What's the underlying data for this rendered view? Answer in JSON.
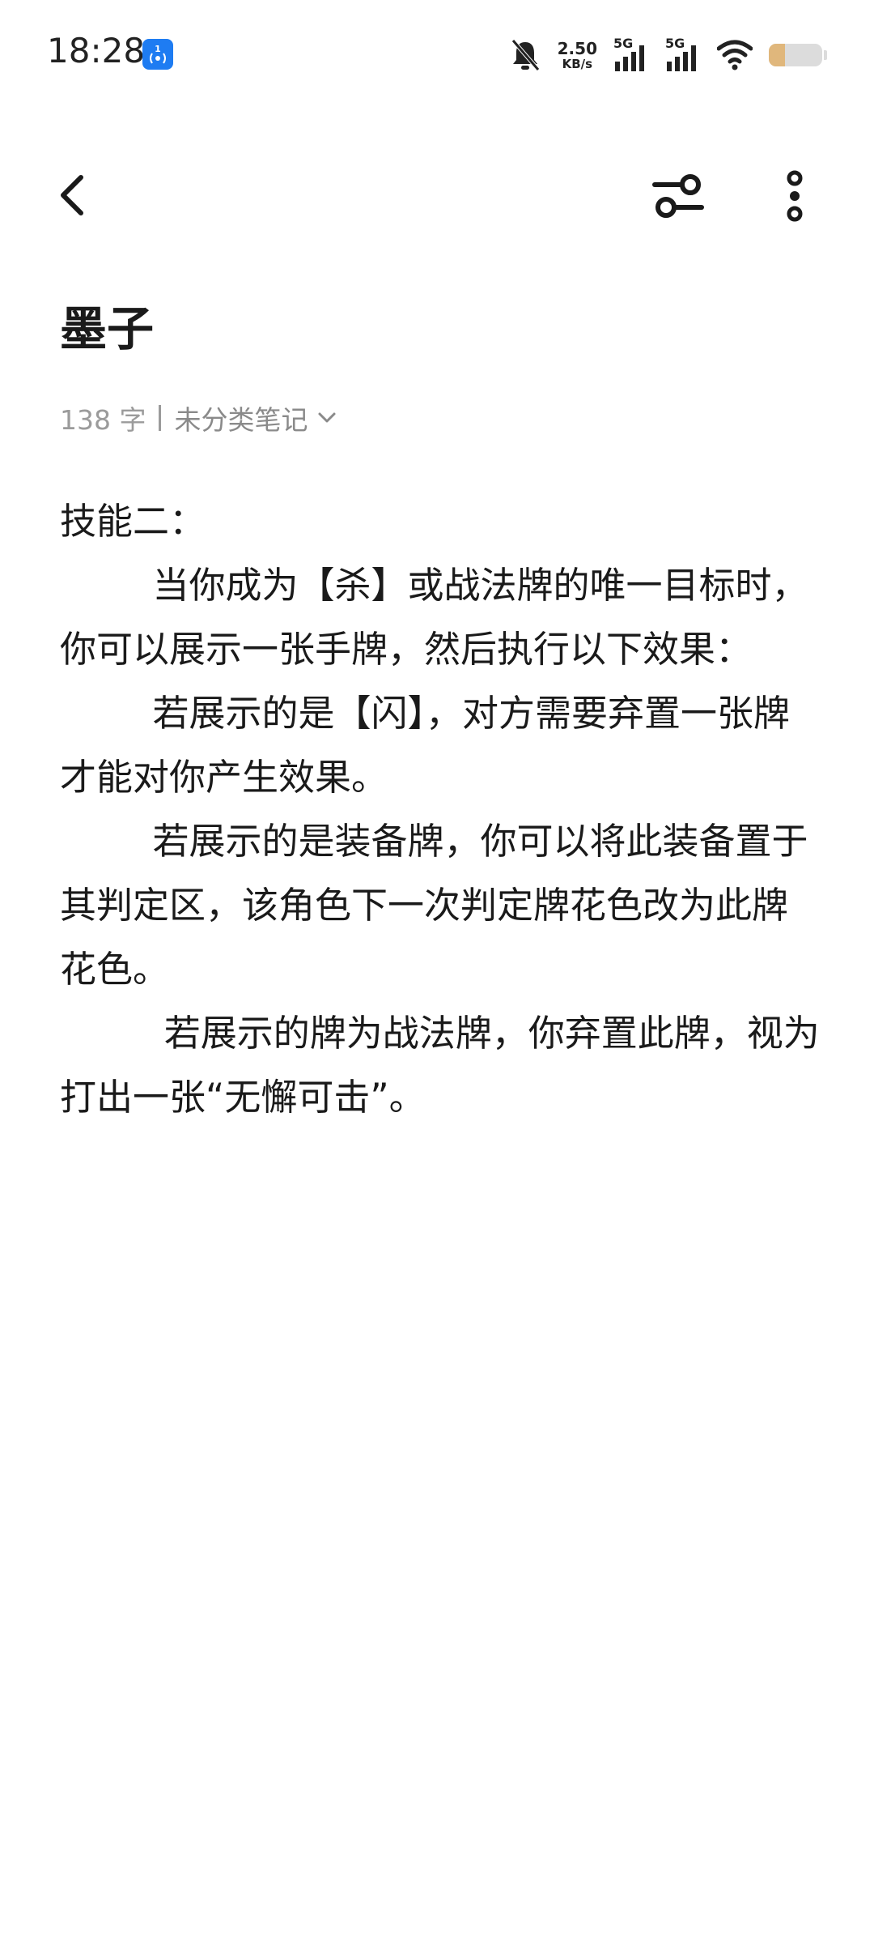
{
  "status_bar": {
    "time": "18:28",
    "net_speed_value": "2.50",
    "net_speed_unit": "KB/s",
    "sim1_label": "5G",
    "sim2_label": "5G",
    "battery_level": 0.3,
    "icons": [
      "app-notification-icon",
      "bell-muted-icon",
      "signal-icon",
      "signal-icon",
      "wifi-icon",
      "battery-icon"
    ]
  },
  "toolbar": {
    "icons": [
      "chevron-left-icon",
      "sliders-icon",
      "more-vertical-icon"
    ]
  },
  "note": {
    "title": "墨子",
    "word_count": "138 字",
    "category": "未分类笔记",
    "paragraphs": [
      "技能二：",
      "        当你成为【杀】或战法牌的唯一目标时，你可以展示一张手牌，然后执行以下效果：",
      "        若展示的是【闪】，对方需要弃置一张牌才能对你产生效果。",
      "        若展示的是装备牌，你可以将此装备置于其判定区，该角色下一次判定牌花色改为此牌花色。",
      "         若展示的牌为战法牌，你弃置此牌，视为打出一张“无懈可击”。"
    ]
  },
  "colors": {
    "text": "#1a1a1a",
    "meta": "#9b9b9b",
    "accent_blue": "#1e7cf2",
    "battery_fill": "#e0b77c"
  }
}
